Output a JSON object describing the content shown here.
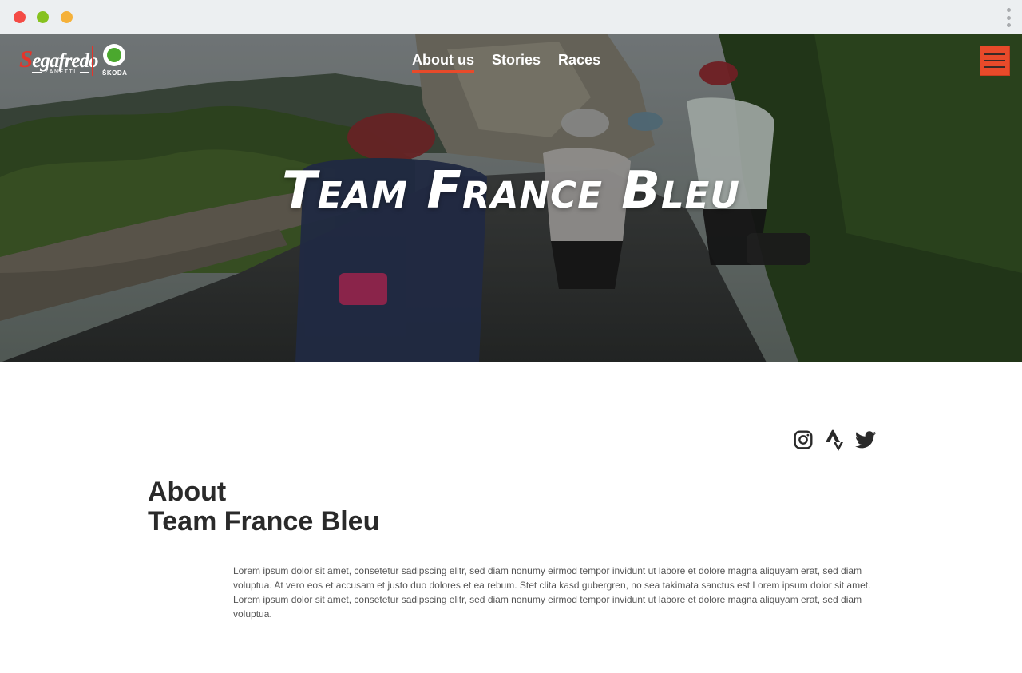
{
  "window": {
    "controls": [
      "close",
      "minimize",
      "maximize"
    ],
    "menu_icon": "kebab-menu-icon"
  },
  "header": {
    "logo": {
      "brand_main": "egafredo",
      "brand_initial": "S",
      "brand_sub": "ZANETTI",
      "partner": "ŠKODA"
    },
    "nav": [
      {
        "label": "About us",
        "active": true
      },
      {
        "label": "Stories",
        "active": false
      },
      {
        "label": "Races",
        "active": false
      }
    ],
    "menu_button_icon": "hamburger-icon",
    "accent_color": "#e84a2a"
  },
  "hero": {
    "title": "Team France Bleu"
  },
  "social": {
    "icons": [
      "instagram-icon",
      "strava-icon",
      "twitter-icon"
    ]
  },
  "about": {
    "title_line1": "About",
    "title_line2": "Team France Bleu",
    "body": "Lorem ipsum dolor sit amet, consetetur sadipscing elitr, sed diam nonumy eirmod tempor invidunt ut labore et dolore magna aliquyam erat, sed diam voluptua. At vero eos et accusam et justo duo dolores et ea rebum. Stet clita kasd gubergren, no sea takimata sanctus est Lorem ipsum dolor sit amet. Lorem ipsum dolor sit amet, consetetur sadipscing elitr, sed diam nonumy eirmod tempor invidunt ut labore et dolore magna aliquyam erat, sed diam voluptua."
  }
}
